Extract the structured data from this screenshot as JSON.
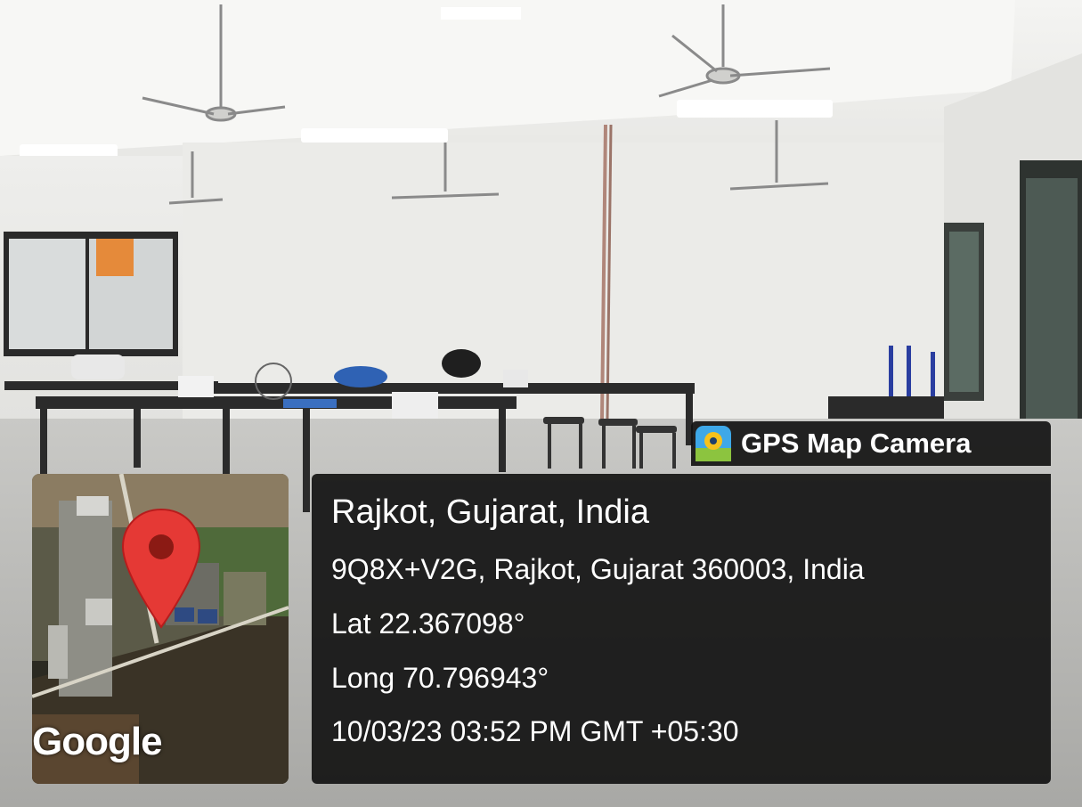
{
  "app": {
    "name": "GPS Map Camera",
    "icon": "gps-map-camera-icon"
  },
  "location": {
    "city": "Rajkot, Gujarat, India",
    "address": "9Q8X+V2G, Rajkot, Gujarat 360003, India",
    "latitude": "Lat 22.367098°",
    "longitude": "Long 70.796943°",
    "datetime": "10/03/23 03:52 PM GMT +05:30"
  },
  "map": {
    "brand": "Google",
    "pin_icon": "map-pin-icon",
    "pin_color": "#e53935"
  },
  "colors": {
    "panel_bg": "#121212",
    "text": "#ffffff"
  }
}
